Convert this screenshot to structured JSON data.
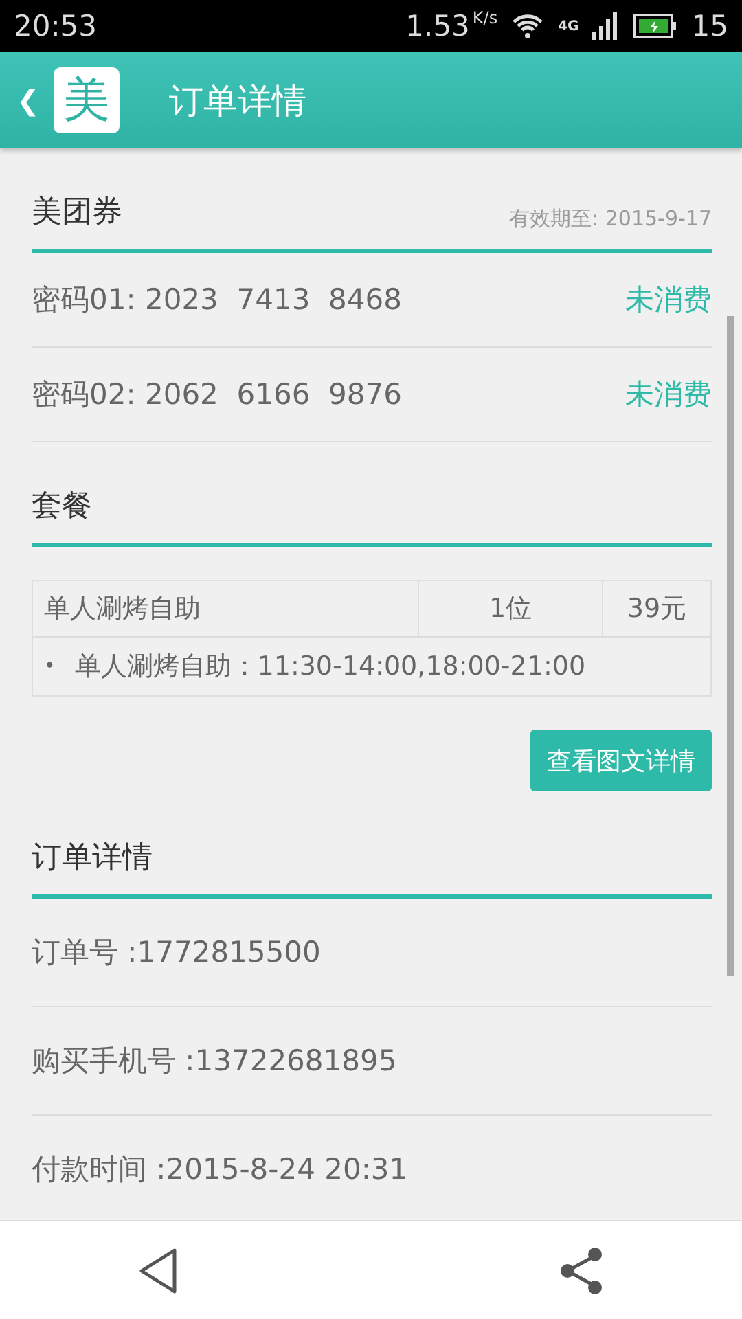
{
  "status_bar": {
    "time": "20:53",
    "speed": "1.53",
    "speed_unit": "K/s",
    "network": "4G",
    "battery": "15"
  },
  "header": {
    "back": "❮",
    "logo": "美",
    "title": "订单详情"
  },
  "voucher": {
    "title": "美团券",
    "expiry": "有效期至: 2015-9-17",
    "codes": [
      {
        "label": "密码01:",
        "code": "2023  7413  8468",
        "status": "未消费"
      },
      {
        "label": "密码02:",
        "code": "2062  6166  9876",
        "status": "未消费"
      }
    ]
  },
  "package": {
    "title": "套餐",
    "table": {
      "rows": [
        {
          "name": "单人涮烤自助",
          "qty": "1位",
          "price": "39元"
        }
      ],
      "notes": [
        {
          "bullet": "•",
          "text": "单人涮烤自助：11:30-14:00,18:00-21:00"
        }
      ]
    },
    "button": "查看图文详情"
  },
  "order": {
    "title": "订单详情",
    "fields": [
      {
        "text": "订单号 :1772815500"
      },
      {
        "text": "购买手机号 :13722681895"
      },
      {
        "text": "付款时间 :2015-8-24 20:31"
      }
    ]
  }
}
